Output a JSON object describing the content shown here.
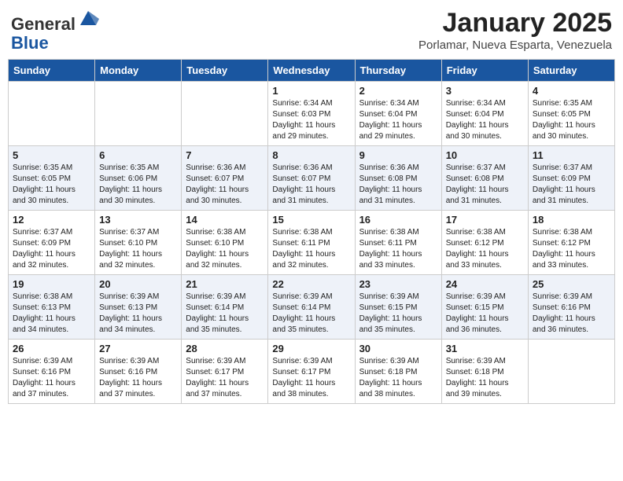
{
  "header": {
    "logo_general": "General",
    "logo_blue": "Blue",
    "month_title": "January 2025",
    "location": "Porlamar, Nueva Esparta, Venezuela"
  },
  "days_of_week": [
    "Sunday",
    "Monday",
    "Tuesday",
    "Wednesday",
    "Thursday",
    "Friday",
    "Saturday"
  ],
  "weeks": [
    [
      {
        "day": "",
        "info": ""
      },
      {
        "day": "",
        "info": ""
      },
      {
        "day": "",
        "info": ""
      },
      {
        "day": "1",
        "info": "Sunrise: 6:34 AM\nSunset: 6:03 PM\nDaylight: 11 hours and 29 minutes."
      },
      {
        "day": "2",
        "info": "Sunrise: 6:34 AM\nSunset: 6:04 PM\nDaylight: 11 hours and 29 minutes."
      },
      {
        "day": "3",
        "info": "Sunrise: 6:34 AM\nSunset: 6:04 PM\nDaylight: 11 hours and 30 minutes."
      },
      {
        "day": "4",
        "info": "Sunrise: 6:35 AM\nSunset: 6:05 PM\nDaylight: 11 hours and 30 minutes."
      }
    ],
    [
      {
        "day": "5",
        "info": "Sunrise: 6:35 AM\nSunset: 6:05 PM\nDaylight: 11 hours and 30 minutes."
      },
      {
        "day": "6",
        "info": "Sunrise: 6:35 AM\nSunset: 6:06 PM\nDaylight: 11 hours and 30 minutes."
      },
      {
        "day": "7",
        "info": "Sunrise: 6:36 AM\nSunset: 6:07 PM\nDaylight: 11 hours and 30 minutes."
      },
      {
        "day": "8",
        "info": "Sunrise: 6:36 AM\nSunset: 6:07 PM\nDaylight: 11 hours and 31 minutes."
      },
      {
        "day": "9",
        "info": "Sunrise: 6:36 AM\nSunset: 6:08 PM\nDaylight: 11 hours and 31 minutes."
      },
      {
        "day": "10",
        "info": "Sunrise: 6:37 AM\nSunset: 6:08 PM\nDaylight: 11 hours and 31 minutes."
      },
      {
        "day": "11",
        "info": "Sunrise: 6:37 AM\nSunset: 6:09 PM\nDaylight: 11 hours and 31 minutes."
      }
    ],
    [
      {
        "day": "12",
        "info": "Sunrise: 6:37 AM\nSunset: 6:09 PM\nDaylight: 11 hours and 32 minutes."
      },
      {
        "day": "13",
        "info": "Sunrise: 6:37 AM\nSunset: 6:10 PM\nDaylight: 11 hours and 32 minutes."
      },
      {
        "day": "14",
        "info": "Sunrise: 6:38 AM\nSunset: 6:10 PM\nDaylight: 11 hours and 32 minutes."
      },
      {
        "day": "15",
        "info": "Sunrise: 6:38 AM\nSunset: 6:11 PM\nDaylight: 11 hours and 32 minutes."
      },
      {
        "day": "16",
        "info": "Sunrise: 6:38 AM\nSunset: 6:11 PM\nDaylight: 11 hours and 33 minutes."
      },
      {
        "day": "17",
        "info": "Sunrise: 6:38 AM\nSunset: 6:12 PM\nDaylight: 11 hours and 33 minutes."
      },
      {
        "day": "18",
        "info": "Sunrise: 6:38 AM\nSunset: 6:12 PM\nDaylight: 11 hours and 33 minutes."
      }
    ],
    [
      {
        "day": "19",
        "info": "Sunrise: 6:38 AM\nSunset: 6:13 PM\nDaylight: 11 hours and 34 minutes."
      },
      {
        "day": "20",
        "info": "Sunrise: 6:39 AM\nSunset: 6:13 PM\nDaylight: 11 hours and 34 minutes."
      },
      {
        "day": "21",
        "info": "Sunrise: 6:39 AM\nSunset: 6:14 PM\nDaylight: 11 hours and 35 minutes."
      },
      {
        "day": "22",
        "info": "Sunrise: 6:39 AM\nSunset: 6:14 PM\nDaylight: 11 hours and 35 minutes."
      },
      {
        "day": "23",
        "info": "Sunrise: 6:39 AM\nSunset: 6:15 PM\nDaylight: 11 hours and 35 minutes."
      },
      {
        "day": "24",
        "info": "Sunrise: 6:39 AM\nSunset: 6:15 PM\nDaylight: 11 hours and 36 minutes."
      },
      {
        "day": "25",
        "info": "Sunrise: 6:39 AM\nSunset: 6:16 PM\nDaylight: 11 hours and 36 minutes."
      }
    ],
    [
      {
        "day": "26",
        "info": "Sunrise: 6:39 AM\nSunset: 6:16 PM\nDaylight: 11 hours and 37 minutes."
      },
      {
        "day": "27",
        "info": "Sunrise: 6:39 AM\nSunset: 6:16 PM\nDaylight: 11 hours and 37 minutes."
      },
      {
        "day": "28",
        "info": "Sunrise: 6:39 AM\nSunset: 6:17 PM\nDaylight: 11 hours and 37 minutes."
      },
      {
        "day": "29",
        "info": "Sunrise: 6:39 AM\nSunset: 6:17 PM\nDaylight: 11 hours and 38 minutes."
      },
      {
        "day": "30",
        "info": "Sunrise: 6:39 AM\nSunset: 6:18 PM\nDaylight: 11 hours and 38 minutes."
      },
      {
        "day": "31",
        "info": "Sunrise: 6:39 AM\nSunset: 6:18 PM\nDaylight: 11 hours and 39 minutes."
      },
      {
        "day": "",
        "info": ""
      }
    ]
  ]
}
